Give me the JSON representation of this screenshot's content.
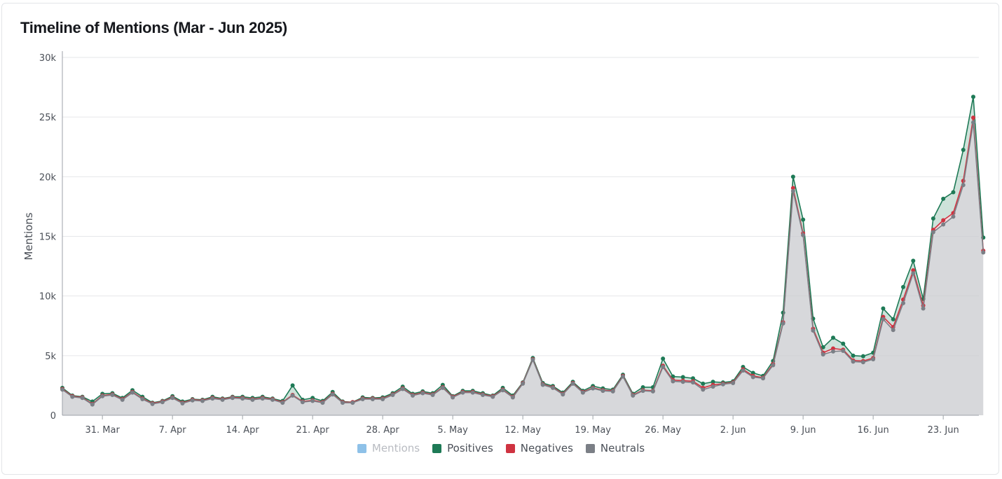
{
  "header": {
    "title": "Timeline of Mentions (Mar - Jun 2025)"
  },
  "colors": {
    "mentions": "#8ec1e8",
    "positives": "#1e7a56",
    "negatives": "#cf3341",
    "neutrals": "#7b7f86",
    "grid": "#e6e7ea",
    "axis": "#9ea2a8",
    "text": "#4a4f57"
  },
  "chart_data": {
    "type": "area",
    "title": "Timeline of Mentions (Mar - Jun 2025)",
    "xlabel": "",
    "ylabel": "Mentions",
    "ylim": [
      0,
      30000
    ],
    "grid": true,
    "legend_position": "bottom",
    "x_start": "2025-03-27",
    "yticks": [
      0,
      5000,
      10000,
      15000,
      20000,
      25000,
      30000
    ],
    "ytick_labels": [
      "0",
      "5k",
      "10k",
      "15k",
      "20k",
      "25k",
      "30k"
    ],
    "xticks": [
      "2025-03-31",
      "2025-04-07",
      "2025-04-14",
      "2025-04-21",
      "2025-04-28",
      "2025-05-05",
      "2025-05-12",
      "2025-05-19",
      "2025-05-26",
      "2025-06-02",
      "2025-06-09",
      "2025-06-16",
      "2025-06-23"
    ],
    "xtick_labels": [
      "31. Mar",
      "7. Apr",
      "14. Apr",
      "21. Apr",
      "28. Apr",
      "5. May",
      "12. May",
      "19. May",
      "26. May",
      "2. Jun",
      "9. Jun",
      "16. Jun",
      "23. Jun"
    ],
    "series": [
      {
        "name": "Mentions",
        "key": "mentions",
        "visible": false,
        "values": []
      },
      {
        "name": "Positives",
        "key": "positives",
        "visible": true,
        "values": [
          2300,
          1650,
          1550,
          1150,
          1800,
          1850,
          1450,
          2100,
          1550,
          1050,
          1200,
          1600,
          1150,
          1350,
          1300,
          1550,
          1400,
          1550,
          1550,
          1450,
          1550,
          1400,
          1200,
          2500,
          1300,
          1450,
          1200,
          1950,
          1150,
          1100,
          1500,
          1450,
          1500,
          1850,
          2400,
          1800,
          2000,
          1850,
          2550,
          1600,
          2050,
          2050,
          1850,
          1650,
          2300,
          1650,
          2750,
          4800,
          2700,
          2450,
          1900,
          2800,
          2050,
          2450,
          2250,
          2150,
          3400,
          1800,
          2350,
          2350,
          4750,
          3250,
          3200,
          3100,
          2650,
          2800,
          2750,
          2850,
          4050,
          3550,
          3300,
          4550,
          8600,
          20000,
          16400,
          8100,
          5700,
          6500,
          6000,
          5000,
          4950,
          5250,
          8950,
          8050,
          10750,
          12950,
          9750,
          16500,
          18150,
          18700,
          22250,
          26700,
          14900
        ]
      },
      {
        "name": "Negatives",
        "key": "negatives",
        "visible": true,
        "values": [
          2200,
          1600,
          1500,
          950,
          1650,
          1750,
          1350,
          1950,
          1400,
          1000,
          1150,
          1500,
          1050,
          1300,
          1250,
          1450,
          1350,
          1500,
          1450,
          1350,
          1450,
          1350,
          1100,
          1700,
          1150,
          1250,
          1100,
          1800,
          1100,
          1100,
          1400,
          1400,
          1400,
          1750,
          2250,
          1700,
          1900,
          1750,
          2350,
          1550,
          1950,
          1950,
          1750,
          1600,
          2150,
          1550,
          2700,
          4700,
          2600,
          2350,
          1800,
          2700,
          1950,
          2300,
          2100,
          2050,
          3300,
          1700,
          2100,
          2050,
          4150,
          2950,
          2900,
          2850,
          2300,
          2550,
          2650,
          2750,
          3850,
          3300,
          3150,
          4300,
          7800,
          19050,
          15250,
          7250,
          5250,
          5600,
          5500,
          4600,
          4550,
          4800,
          8250,
          7400,
          9700,
          12150,
          9200,
          15550,
          16350,
          16950,
          19650,
          24950,
          13800
        ]
      },
      {
        "name": "Neutrals",
        "key": "neutrals",
        "visible": true,
        "values": [
          2150,
          1550,
          1450,
          900,
          1600,
          1700,
          1300,
          1900,
          1350,
          950,
          1100,
          1450,
          1000,
          1250,
          1200,
          1400,
          1300,
          1450,
          1400,
          1300,
          1400,
          1300,
          1050,
          1650,
          1100,
          1200,
          1050,
          1750,
          1050,
          1050,
          1350,
          1350,
          1350,
          1700,
          2200,
          1650,
          1850,
          1700,
          2300,
          1500,
          1900,
          1900,
          1700,
          1550,
          2100,
          1500,
          2650,
          4650,
          2550,
          2300,
          1750,
          2650,
          1900,
          2250,
          2050,
          2000,
          3250,
          1650,
          2050,
          2000,
          4050,
          2850,
          2800,
          2750,
          2150,
          2400,
          2600,
          2700,
          3750,
          3200,
          3100,
          4200,
          7700,
          18800,
          15100,
          7100,
          5100,
          5350,
          5400,
          4500,
          4450,
          4700,
          8050,
          7150,
          9400,
          11900,
          8950,
          15350,
          16000,
          16650,
          19300,
          24550,
          13650
        ]
      }
    ]
  }
}
